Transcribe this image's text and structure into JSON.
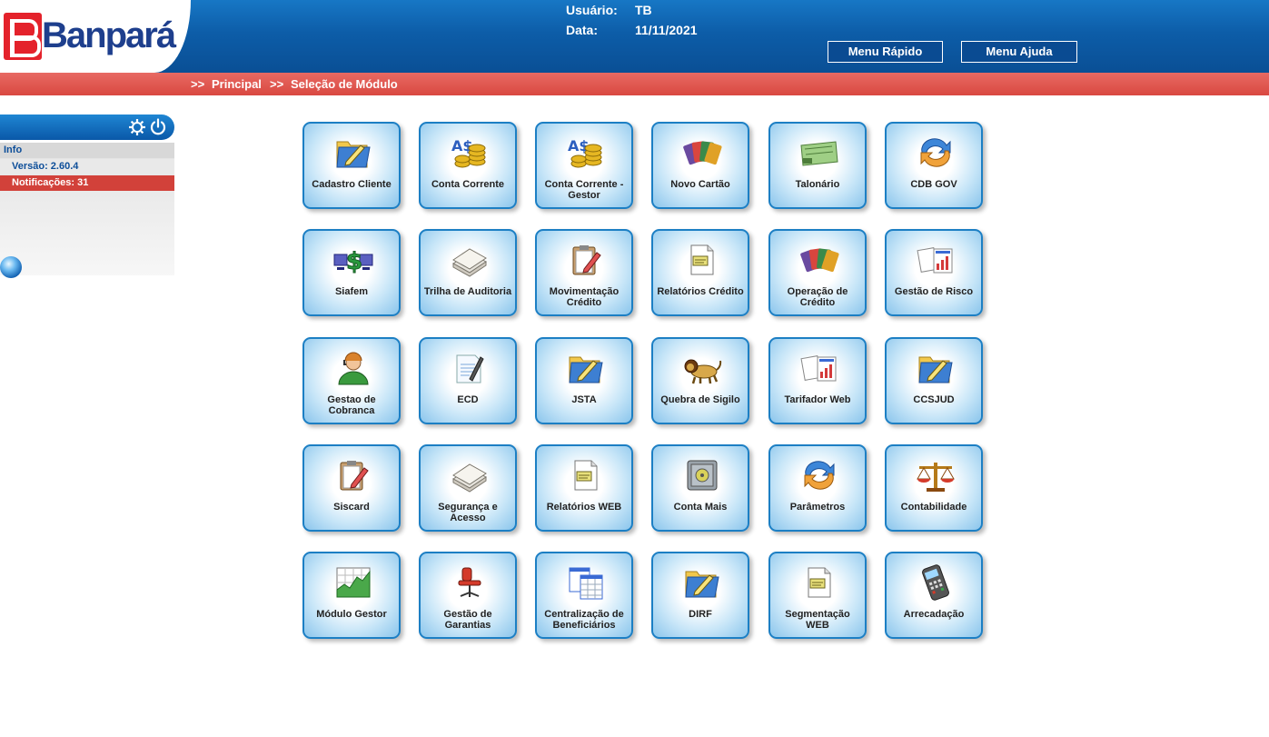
{
  "header": {
    "brand": "Banpará",
    "user_label": "Usuário:",
    "user_value": "TB",
    "date_label": "Data:",
    "date_value": "11/11/2021",
    "menu_rapido": "Menu Rápido",
    "menu_ajuda": "Menu Ajuda"
  },
  "breadcrumb": {
    "sep1": ">>",
    "principal": "Principal",
    "sep2": ">>",
    "current": "Seleção de Módulo"
  },
  "sidebar": {
    "info_label": "Info",
    "version": "Versão: 2.60.4",
    "notifications": "Notificações: 31",
    "icons": [
      "settings-icon",
      "power-icon",
      "globe-icon"
    ]
  },
  "modules": [
    {
      "label": "Cadastro Cliente",
      "icon": "folder-pencil-icon"
    },
    {
      "label": "Conta Corrente",
      "icon": "coins-icon"
    },
    {
      "label": "Conta Corrente - Gestor",
      "icon": "coins-icon"
    },
    {
      "label": "Novo Cartão",
      "icon": "cards-icon"
    },
    {
      "label": "Talonário",
      "icon": "checkbook-icon"
    },
    {
      "label": "CDB GOV",
      "icon": "refresh-arrows-icon"
    },
    {
      "label": "Siafem",
      "icon": "computers-dollar-icon"
    },
    {
      "label": "Trilha de Auditoria",
      "icon": "paper-stack-icon"
    },
    {
      "label": "Movimentação Crédito",
      "icon": "clipboard-pencil-icon"
    },
    {
      "label": "Relatórios Crédito",
      "icon": "report-document-icon"
    },
    {
      "label": "Operação de Crédito",
      "icon": "cards-icon"
    },
    {
      "label": "Gestão de Risco",
      "icon": "charts-document-icon"
    },
    {
      "label": "Gestao de Cobranca",
      "icon": "operator-headset-icon"
    },
    {
      "label": "ECD",
      "icon": "document-pen-icon"
    },
    {
      "label": "JSTA",
      "icon": "folder-pencil-icon"
    },
    {
      "label": "Quebra de Sigilo",
      "icon": "lion-icon"
    },
    {
      "label": "Tarifador Web",
      "icon": "charts-document-icon"
    },
    {
      "label": "CCSJUD",
      "icon": "folder-pencil-icon"
    },
    {
      "label": "Siscard",
      "icon": "clipboard-pencil-icon"
    },
    {
      "label": "Segurança e Acesso",
      "icon": "paper-stack-icon"
    },
    {
      "label": "Relatórios WEB",
      "icon": "report-document-icon"
    },
    {
      "label": "Conta Mais",
      "icon": "safe-icon"
    },
    {
      "label": "Parâmetros",
      "icon": "refresh-arrows-icon"
    },
    {
      "label": "Contabilidade",
      "icon": "scales-icon"
    },
    {
      "label": "Módulo Gestor",
      "icon": "growth-chart-icon"
    },
    {
      "label": "Gestão de Garantias",
      "icon": "office-chair-icon"
    },
    {
      "label": "Centralização de Beneficiários",
      "icon": "spreadsheets-icon"
    },
    {
      "label": "DIRF",
      "icon": "folder-pencil-icon"
    },
    {
      "label": "Segmentação WEB",
      "icon": "report-document-icon"
    },
    {
      "label": "Arrecadação",
      "icon": "card-terminal-icon"
    }
  ]
}
